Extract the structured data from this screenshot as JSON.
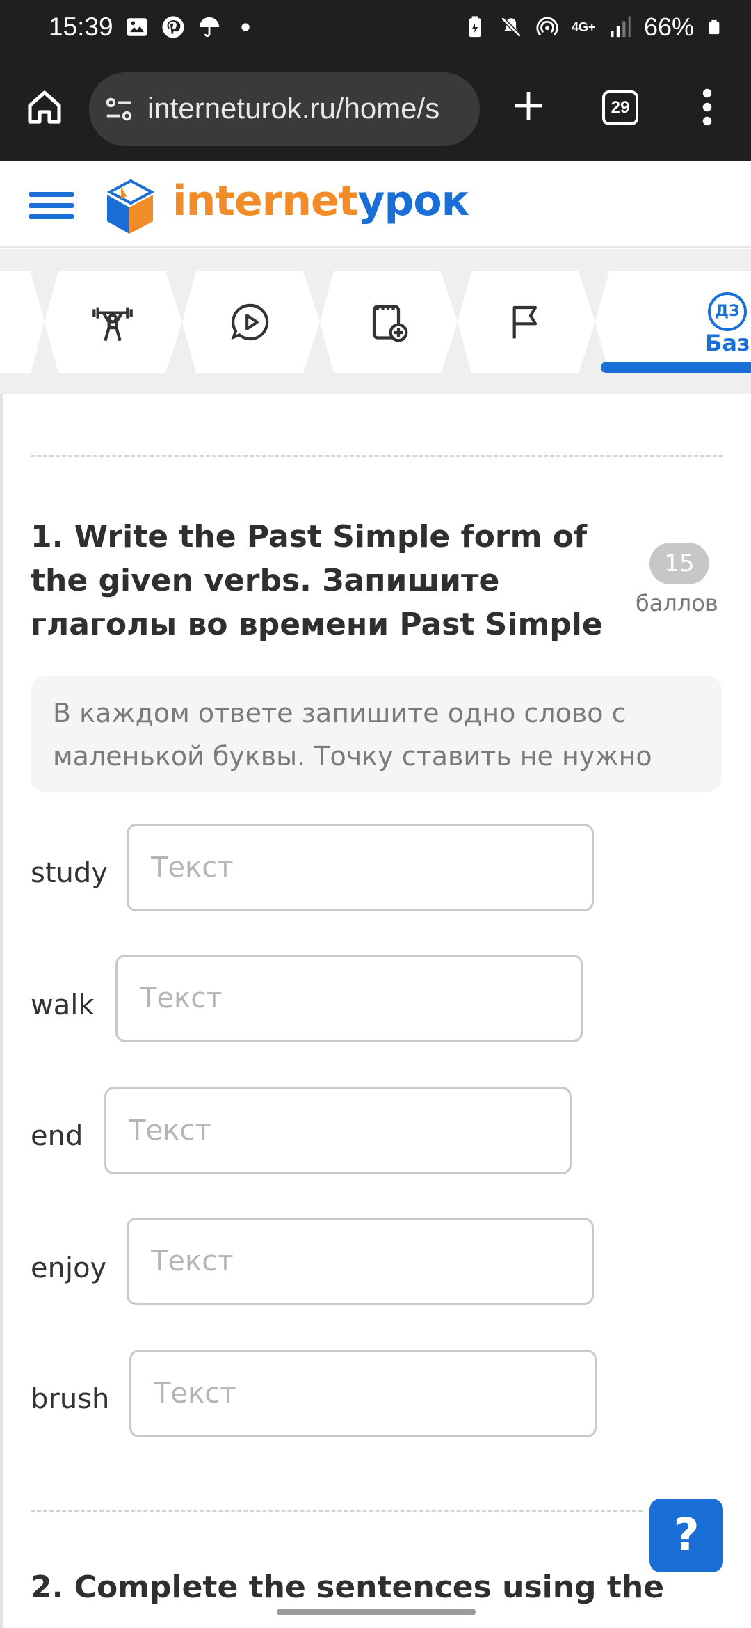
{
  "status_bar": {
    "time": "15:39",
    "battery": "66%",
    "network": "4G+",
    "icons": [
      "image-icon",
      "pinterest-icon",
      "umbrella-icon",
      "dot-icon",
      "battery-saver-icon",
      "mute-icon",
      "hotspot-icon",
      "signal-icon",
      "battery-icon"
    ]
  },
  "browser": {
    "url": "interneturok.ru/home/s",
    "tab_count": "29"
  },
  "site": {
    "logo_part1": "internet",
    "logo_part2": "урок",
    "brand_colors": {
      "orange": "#f28c28",
      "blue": "#1a6fd6"
    }
  },
  "steps": {
    "icons": [
      "weightlifter-icon",
      "video-chat-icon",
      "notebook-add-icon",
      "flag-icon",
      "homework-icon"
    ],
    "active_badge": "ДЗ",
    "active_label": "База"
  },
  "question1": {
    "title": "1. Write the Past Simple form of the given verbs. Запишите глаголы во времени Past Simple",
    "score_value": "15",
    "score_label": "баллов",
    "hint": "В каждом ответе запишите одно слово с маленькой буквы. Точку ставить не нужно",
    "rows": [
      {
        "label": "study",
        "value": "",
        "placeholder": "Текст"
      },
      {
        "label": "walk",
        "value": "",
        "placeholder": "Текст"
      },
      {
        "label": "end",
        "value": "",
        "placeholder": "Текст"
      },
      {
        "label": "enjoy",
        "value": "",
        "placeholder": "Текст"
      },
      {
        "label": "brush",
        "value": "",
        "placeholder": "Текст"
      }
    ]
  },
  "help_button": "?",
  "question2": {
    "title": "2. Complete the sentences using the"
  }
}
